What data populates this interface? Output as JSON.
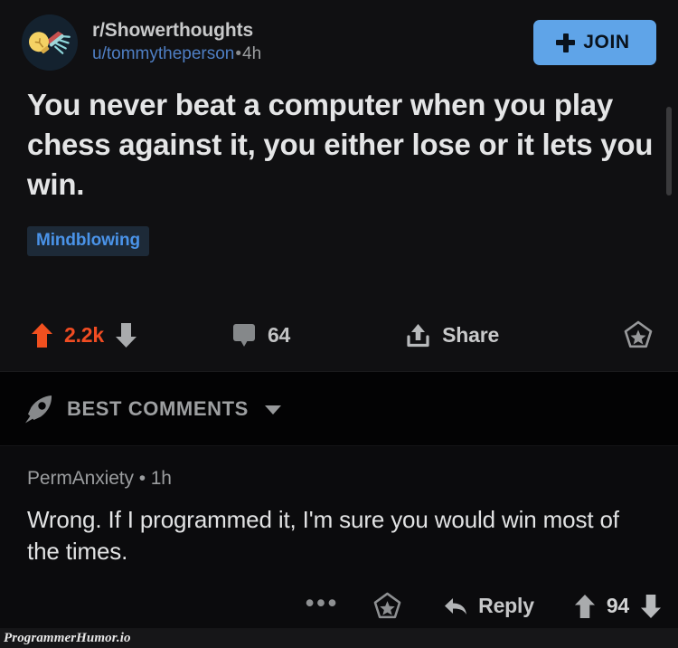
{
  "post": {
    "subreddit": "r/Showerthoughts",
    "author": "u/tommytheperson",
    "separator": "•",
    "age": "4h",
    "join_label": "JOIN",
    "join_icon": "plus-icon",
    "avatar_icon": "showerthoughts-lightbulb-showerhead-icon",
    "title": "You never beat a computer when you play chess against it, you either lose or it lets you win.",
    "flair": "Mindblowing",
    "actions": {
      "upvote_icon": "upvote-arrow-icon",
      "score": "2.2k",
      "downvote_icon": "downvote-arrow-icon",
      "comment_icon": "comment-bubble-icon",
      "comment_count": "64",
      "share_icon": "share-icon",
      "share_label": "Share",
      "save_icon": "award-star-icon"
    }
  },
  "comments_header": {
    "icon": "rocket-icon",
    "label": "BEST COMMENTS",
    "chevron_icon": "chevron-down-icon"
  },
  "comment": {
    "author": "PermAnxiety",
    "separator": "•",
    "age": "1h",
    "body": "Wrong. If I programmed it, I'm sure you would win most of the times.",
    "actions": {
      "more_icon": "overflow-dots-icon",
      "more_label": "•••",
      "award_icon": "award-star-icon",
      "reply_icon": "reply-arrow-icon",
      "reply_label": "Reply",
      "upvote_icon": "upvote-arrow-icon",
      "score": "94",
      "downvote_icon": "downvote-arrow-icon"
    }
  },
  "watermark": "ProgrammerHumor.io",
  "colors": {
    "accent_upvote": "#f14c22",
    "join_button": "#5fa4e8",
    "flair_text": "#4a93e8",
    "flair_bg": "#1d2a38",
    "username_link": "#4f7fc4",
    "page_bg": "#101012"
  }
}
